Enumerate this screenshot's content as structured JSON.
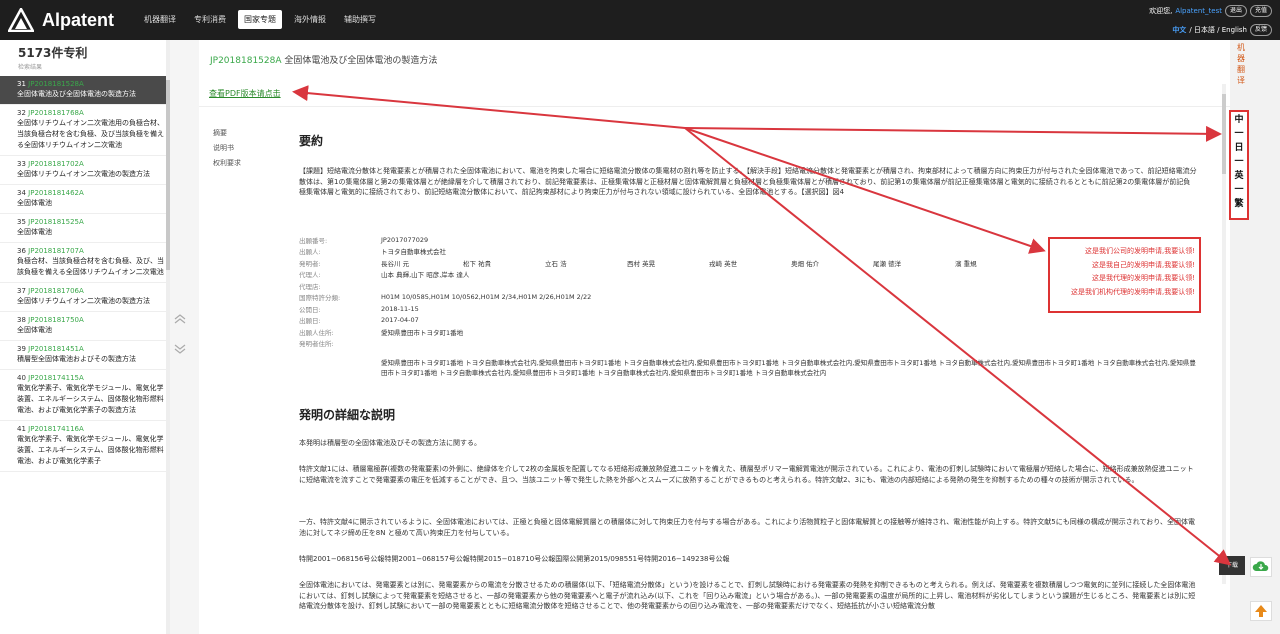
{
  "brand": {
    "name": "Alpatent"
  },
  "nav": [
    {
      "label": "机器翻译",
      "active": false
    },
    {
      "label": "专利消费",
      "active": false
    },
    {
      "label": "国家专题",
      "active": true
    },
    {
      "label": "海外情报",
      "active": false
    },
    {
      "label": "辅助撰写",
      "active": false
    }
  ],
  "header_right": {
    "greeting": "欢迎您,",
    "username": "Alpatent_test",
    "logout": "退出",
    "settings": "充值",
    "lang_cn": "中文",
    "lang_rest": "/ 日本語 / English",
    "feedback": "反馈"
  },
  "sidebar": {
    "count": "5173件专利",
    "sub": "检索结果",
    "items": [
      {
        "num": "31",
        "id": "JP2018181528A",
        "title": "全固体電池及び全固体電池の製造方法"
      },
      {
        "num": "32",
        "id": "JP2018181768A",
        "title": "全固体リチウムイオン二次電池用の負極合材、当該負極合材を含む負極、及び当該負極を備える全固体リチウムイオン二次電池"
      },
      {
        "num": "33",
        "id": "JP2018181702A",
        "title": "全固体リチウムイオン二次電池の製造方法"
      },
      {
        "num": "34",
        "id": "JP2018181462A",
        "title": "全固体電池"
      },
      {
        "num": "35",
        "id": "JP2018181525A",
        "title": "全固体電池"
      },
      {
        "num": "36",
        "id": "JP2018181707A",
        "title": "負極合材、当該負極合材を含む負極、及び、当該負極を備える全固体リチウムイオン二次電池"
      },
      {
        "num": "37",
        "id": "JP2018181706A",
        "title": "全固体リチウムイオン二次電池の製造方法"
      },
      {
        "num": "38",
        "id": "JP2018181750A",
        "title": "全固体電池"
      },
      {
        "num": "39",
        "id": "JP2018181451A",
        "title": "積層型全固体電池およびその製造方法"
      },
      {
        "num": "40",
        "id": "JP2018174115A",
        "title": "電気化学素子、電気化学モジュール、電気化学装置、エネルギーシステム、固体酸化物形燃料電池、および電気化学素子の製造方法"
      },
      {
        "num": "41",
        "id": "JP2018174116A",
        "title": "電気化学素子、電気化学モジュール、電気化学装置、エネルギーシステム、固体酸化物形燃料電池、および電気化学素子"
      }
    ]
  },
  "doc": {
    "id": "JP2018181528A",
    "title": "全固体電池及び全固体電池の製造方法",
    "pdf_link": "查看PDF版本请点击",
    "toc": [
      "摘要",
      "说明书",
      "权利要求"
    ],
    "abstract_heading": "要約",
    "abstract": "【課題】短絡電流分散体と発電要素とが積層された全固体電池において、電池を拘束した場合に短絡電流分散体の集電材の割れ等を防止する。【解決手段】短絡電流分散体と発電要素とが積層され、拘束部材によって積層方向に拘束圧力が付与された全固体電池であって、前記短絡電流分散体は、第1の集電体層と第2の集電体層とが絶縁層を介して積層されており、前記発電要素は、正極集電体層と正極材層と固体電解質層と負極材層と負極集電体層とが積層されており、前記第1の集電体層が前記正極集電体層と電気的に接続されるとともに前記第2の集電体層が前記負極集電体層と電気的に接続されており、前記短絡電流分散体において、前記拘束部材により拘束圧力が付与されない領域に設けられている、全固体電池とする。【選択図】図4",
    "info": {
      "app_no_label": "出願番号:",
      "app_no": "JP2017077029",
      "applicant_label": "出願人:",
      "applicant": "トヨタ自動車株式会社",
      "inventor_label": "発明者:",
      "inventors": [
        "長谷川 元",
        "松下 祐貴",
        "立石 浩",
        "西村 英晃",
        "戎崎 英世",
        "奥畑 佑介",
        "尾瀬 徳洋",
        "濱 重規"
      ],
      "agent_label": "代理人:",
      "agent": "山本 典輝,山下 昭彦,岸本 達人",
      "agent2_label": "代理店:",
      "agent2": "",
      "ipc_label": "国際特許分類:",
      "ipc": "H01M 10/0585,H01M 10/0562,H01M 2/34,H01M 2/26,H01M 2/22",
      "pub_label": "公開日:",
      "pub": "2018-11-15",
      "filed_label": "出願日:",
      "filed": "2017-04-07",
      "addr_label": "出願人住所:",
      "addr": "愛知県豊田市トヨタ町1番地",
      "inv_addr_label": "発明者住所:",
      "inv_addr": "愛知県豊田市トヨタ町1番地 トヨタ自動車株式会社内,愛知県豊田市トヨタ町1番地 トヨタ自動車株式会社内,愛知県豊田市トヨタ町1番地 トヨタ自動車株式会社内,愛知県豊田市トヨタ町1番地 トヨタ自動車株式会社内,愛知県豊田市トヨタ町1番地 トヨタ自動車株式会社内,愛知県豊田市トヨタ町1番地 トヨタ自動車株式会社内,愛知県豊田市トヨタ町1番地 トヨタ自動車株式会社内,愛知県豊田市トヨタ町1番地 トヨタ自動車株式会社内"
    },
    "claims": [
      "这是我们公司的发明申请,我要认领!",
      "这是我自己的发明申请,我要认领!",
      "这是我代理的发明申请,我要认领!",
      "这是我们机构代理的发明申请,我要认领!"
    ],
    "detail_heading": "発明の詳細な説明",
    "detail_p1": "本発明は積層型の全固体電池及びその製造方法に関する。",
    "detail_p2": "特許文献1には、積層電極群(複数の発電要素)の外側に、絶縁体を介して2枚の金属板を配置してなる短絡形成兼放熱促進ユニットを備えた、積層型ポリマー電解質電池が開示されている。これにより、電池の釘刺し試験時において電極層が短絡した場合に、短絡形成兼放熱促進ユニットに短絡電流を流すことで発電要素の電圧を低減することができ、且つ、当該ユニット等で発生した熱を外部へとスムーズに放熱することができるものと考えられる。特許文献2、3にも、電池の内部短絡による発熱の発生を抑制するための種々の技術が開示されている。",
    "detail_p3": "一方、特許文献4に開示されているように、全固体電池においては、正極と負極と固体電解質層との積層体に対して拘束圧力を付与する場合がある。これにより活物質粒子と固体電解質との接触等が維持され、電池性能が向上する。特許文献5にも同様の構成が開示されており、全固体電池に対してネジ締め圧を8N と極めて高い拘束圧力を付与している。",
    "detail_p4": "特開2001−068156号公報特開2001−068157号公報特開2015−018710号公報国際公開第2015/098551号特開2016−149238号公報",
    "detail_p5": "全固体電池においては、発電要素とは別に、発電要素からの電流を分散させるための積層体(以下、「短絡電流分散体」という)を設けることで、釘刺し試験時における発電要素の発熱を抑制できるものと考えられる。例えば、発電要素を複数積層しつつ電気的に並列に接続した全固体電池においては、釘刺し試験によって発電要素を短絡させると、一部の発電要素から他の発電要素へと電子が流れ込み(以下、これを「回り込み電流」という場合がある。)、一部の発電要素の温度が局所的に上昇し、電池材料が劣化してしまうという課題が生じるところ、発電要素とは別に短絡電流分散体を設け、釘刺し試験において一部の発電要素とともに短絡電流分散体を短絡させることで、他の発電要素からの回り込み電流を、一部の発電要素だけでなく、短絡抵抗が小さい短絡電流分散"
  },
  "right_rail": {
    "mt_label": "机器翻译",
    "lang_chars": [
      "中",
      "一",
      "日",
      "一",
      "英",
      "一",
      "繁"
    ],
    "download": "下载"
  },
  "colors": {
    "accent_green": "#3aa84a",
    "alert_red": "#d33",
    "topbar": "#1e1e1e"
  }
}
